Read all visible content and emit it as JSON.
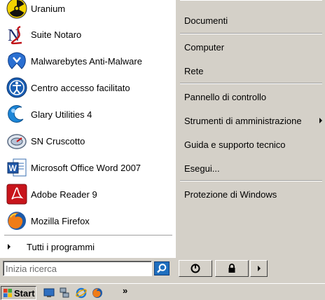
{
  "programs": [
    {
      "label": "Uranium",
      "icon": "radiation-icon"
    },
    {
      "label": "Suite Notaro",
      "icon": "notaro-logo-icon"
    },
    {
      "label": "Malwarebytes Anti-Malware",
      "icon": "malwarebytes-icon"
    },
    {
      "label": "Centro accesso facilitato",
      "icon": "accessibility-icon"
    },
    {
      "label": "Glary Utilities 4",
      "icon": "glary-icon"
    },
    {
      "label": "SN Cruscotto",
      "icon": "cruscotto-icon"
    },
    {
      "label": "Microsoft Office Word 2007",
      "icon": "word-icon"
    },
    {
      "label": "Adobe Reader 9",
      "icon": "acrobat-icon"
    },
    {
      "label": "Mozilla Firefox",
      "icon": "firefox-icon"
    }
  ],
  "all_programs": "Tutti i programmi",
  "right_menu": {
    "documenti": "Documenti",
    "computer": "Computer",
    "rete": "Rete",
    "pannello": "Pannello di controllo",
    "strumenti": "Strumenti di amministrazione",
    "guida": "Guida e supporto tecnico",
    "esegui": "Esegui...",
    "protezione": "Protezione di Windows"
  },
  "search": {
    "placeholder": "Inizia ricerca"
  },
  "taskbar": {
    "start_label": "Start",
    "overflow": "»"
  },
  "colors": {
    "menu_bg": "#d4d0c8",
    "left_bg": "#ffffff",
    "search_btn": "#1f6fbf"
  }
}
